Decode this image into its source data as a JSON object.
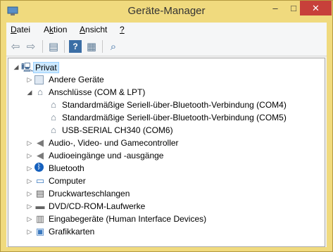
{
  "window": {
    "title": "Geräte-Manager",
    "controls": {
      "minimize": "–",
      "maximize": "□",
      "close": "✕"
    }
  },
  "menu": [
    {
      "label": "Datei",
      "mnemonic": "D"
    },
    {
      "label": "Aktion",
      "mnemonic": "k"
    },
    {
      "label": "Ansicht",
      "mnemonic": "A"
    },
    {
      "label": "?",
      "mnemonic": "?"
    }
  ],
  "toolbar": [
    {
      "name": "back-icon",
      "glyph": "⇦"
    },
    {
      "name": "forward-icon",
      "glyph": "⇨"
    },
    {
      "name": "properties-icon",
      "glyph": "▤"
    },
    {
      "name": "help-icon",
      "glyph": "?"
    },
    {
      "name": "update-driver-icon",
      "glyph": "▦"
    },
    {
      "name": "scan-hardware-icon",
      "glyph": "⌕"
    }
  ],
  "tree": {
    "root": {
      "label": "Privat",
      "expanded": true,
      "selected": true
    },
    "items": [
      {
        "label": "Andere Geräte",
        "level": 1,
        "expander": "collapsed",
        "icon": "other-devices-icon"
      },
      {
        "label": "Anschlüsse (COM & LPT)",
        "level": 1,
        "expander": "expanded",
        "icon": "port-icon"
      },
      {
        "label": "Standardmäßige Seriell-über-Bluetooth-Verbindung (COM4)",
        "level": 2,
        "expander": "none",
        "icon": "port-icon"
      },
      {
        "label": "Standardmäßige Seriell-über-Bluetooth-Verbindung (COM5)",
        "level": 2,
        "expander": "none",
        "icon": "port-icon"
      },
      {
        "label": "USB-SERIAL CH340 (COM6)",
        "level": 2,
        "expander": "none",
        "icon": "port-icon"
      },
      {
        "label": "Audio-, Video- und Gamecontroller",
        "level": 1,
        "expander": "collapsed",
        "icon": "speaker-icon"
      },
      {
        "label": "Audioeingänge und -ausgänge",
        "level": 1,
        "expander": "collapsed",
        "icon": "speaker-icon"
      },
      {
        "label": "Bluetooth",
        "level": 1,
        "expander": "collapsed",
        "icon": "bluetooth-icon"
      },
      {
        "label": "Computer",
        "level": 1,
        "expander": "collapsed",
        "icon": "computer-icon"
      },
      {
        "label": "Druckwarteschlangen",
        "level": 1,
        "expander": "collapsed",
        "icon": "printer-icon"
      },
      {
        "label": "DVD/CD-ROM-Laufwerke",
        "level": 1,
        "expander": "collapsed",
        "icon": "disc-drive-icon"
      },
      {
        "label": "Eingabegeräte (Human Interface Devices)",
        "level": 1,
        "expander": "collapsed",
        "icon": "hid-icon"
      },
      {
        "label": "Grafikkarten",
        "level": 1,
        "expander": "collapsed",
        "icon": "display-adapter-icon"
      }
    ]
  },
  "colors": {
    "frame": "#f0da7e",
    "close": "#c7403a",
    "selection": "#cce8ff"
  }
}
